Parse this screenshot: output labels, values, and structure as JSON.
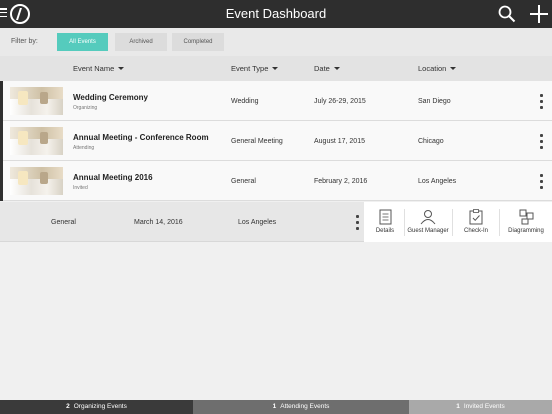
{
  "header": {
    "title": "Event Dashboard"
  },
  "filter": {
    "label": "Filter by:",
    "buttons": [
      "All Events",
      "Archived",
      "Completed"
    ],
    "active": "All Events",
    "accent_color": "#55cbbd"
  },
  "columns": {
    "event_name": "Event Name",
    "event_type": "Event Type",
    "date": "Date",
    "location": "Location"
  },
  "events": [
    {
      "name": "Wedding Ceremony",
      "role": "Organizing",
      "type": "Wedding",
      "date": "July 26-29, 2015",
      "location": "San Diego"
    },
    {
      "name": "Annual Meeting - Conference Room",
      "role": "Attending",
      "type": "General Meeting",
      "date": "August 17, 2015",
      "location": "Chicago"
    },
    {
      "name": "Annual Meeting 2016",
      "role": "Invited",
      "type": "General",
      "date": "February 2, 2016",
      "location": "Los Angeles"
    }
  ],
  "expanded_event": {
    "type": "General",
    "date": "March 14, 2016",
    "location": "Los Angeles"
  },
  "actions": [
    "Details",
    "Guest Manager",
    "Check-In",
    "Diagramming"
  ],
  "bottom_tabs": [
    {
      "count": "2",
      "label": "Organizing Events",
      "color": "#3a3a3a"
    },
    {
      "count": "1",
      "label": "Attending Events",
      "color": "#6e6e6e"
    },
    {
      "count": "1",
      "label": "Invited Events",
      "color": "#a9a9a9"
    }
  ],
  "icons": {
    "menu": "hamburger-icon",
    "logo": "app-logo",
    "search": "search-icon",
    "add": "plus-icon",
    "more": "kebab-icon"
  }
}
